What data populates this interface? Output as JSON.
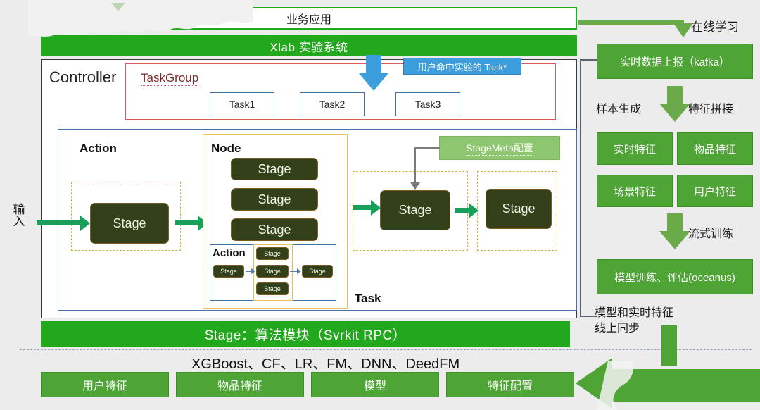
{
  "diagram": {
    "title": "Xlab experiment system architecture",
    "colors": {
      "bright_green": "#22a81c",
      "box_green": "#4fa436",
      "light_green": "#8ec76f",
      "stage_dark": "#33401a",
      "arrow_green": "#17a05a",
      "blue_label": "#3d9ede",
      "red_border": "#e0595c",
      "yellow_border": "#e3c05a",
      "background": "#ececed"
    }
  },
  "left": {
    "business_app": "业务应用",
    "xlab_system": "Xlab 实验系统",
    "input_label": "输入",
    "controller_label": "Controller",
    "taskgroup_label": "TaskGroup",
    "tasks": [
      "Task1",
      "Task2",
      "Task3"
    ],
    "hit_task_label": "用户命中实验的 Task*",
    "action_label": "Action",
    "node_label": "Node",
    "task_label": "Task",
    "stagemeta_label": "StageMeta配置",
    "stage_label": "Stage",
    "node_stages": [
      "Stage",
      "Stage",
      "Stage"
    ],
    "inner_action": {
      "label": "Action",
      "left_stage": "Stage",
      "middle_stages": [
        "Stage",
        "Stage",
        "Stage"
      ],
      "right_stage": "Stage"
    },
    "task_stages": [
      "Stage",
      "Stage"
    ],
    "algo_bar": "Stage：算法模块（Svrkit RPC）",
    "algorithms": "XGBoost、CF、LR、FM、DNN、DeedFM",
    "bottom_boxes": [
      "用户特征",
      "物品特征",
      "模型",
      "特征配置"
    ]
  },
  "right": {
    "online_learning": "在线学习",
    "realtime_report": "实时数据上报（kafka）",
    "sample_generation": "样本生成",
    "feature_join": "特征拼接",
    "features": [
      "实时特征",
      "物品特征",
      "场景特征",
      "用户特征"
    ],
    "streaming_training": "流式训练",
    "model_training": "模型训练、评估(oceanus)",
    "sync_note_line1": "模型和实时特征",
    "sync_note_line2": "线上同步"
  }
}
